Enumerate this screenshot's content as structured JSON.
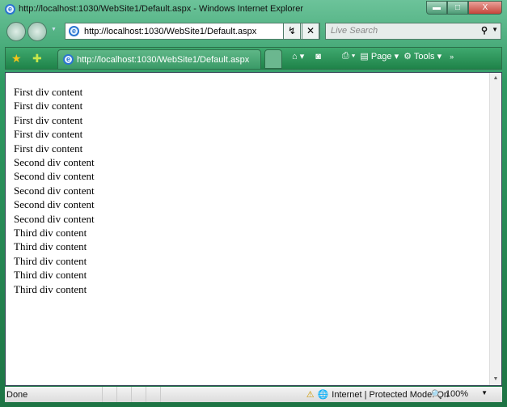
{
  "window": {
    "title": "http://localhost:1030/WebSite1/Default.aspx - Windows Internet Explorer"
  },
  "address": {
    "url": "http://localhost:1030/WebSite1/Default.aspx"
  },
  "search": {
    "placeholder": "Live Search"
  },
  "tab": {
    "label": "http://localhost:1030/WebSite1/Default.aspx"
  },
  "toolbar": {
    "page": "Page",
    "tools": "Tools"
  },
  "content": {
    "lines": [
      "First div content",
      "First div content",
      "First div content",
      "First div content",
      "First div content",
      "Second div content",
      "Second div content",
      "Second div content",
      "Second div content",
      "Second div content",
      "Third div content",
      "Third div content",
      "Third div content",
      "Third div content",
      "Third div content"
    ]
  },
  "status": {
    "text": "Done",
    "zone": "Internet | Protected Mode: On",
    "zoom": "100%"
  }
}
